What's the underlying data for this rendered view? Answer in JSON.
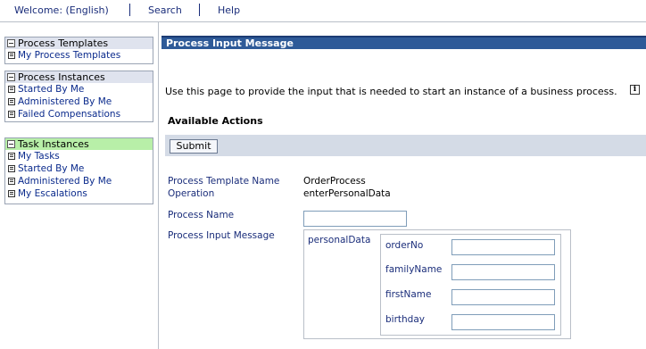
{
  "topnav": {
    "welcome": "Welcome: (English)",
    "search": "Search",
    "help": "Help"
  },
  "sidebar": {
    "groups": [
      {
        "title": "Process Templates",
        "items": [
          "My Process Templates"
        ]
      },
      {
        "title": "Process Instances",
        "items": [
          "Started By Me",
          "Administered By Me",
          "Failed Compensations"
        ]
      },
      {
        "title": "Task Instances",
        "items": [
          "My Tasks",
          "Started By Me",
          "Administered By Me",
          "My Escalations"
        ]
      }
    ],
    "colors": {
      "group_head": "#dfe3ee",
      "task_head_active": "#b8efa8"
    }
  },
  "main": {
    "title": "Process Input Message",
    "intro": "Use this page to provide the input that is needed to start an instance of a business process.",
    "info_icon": "i",
    "available_actions": "Available Actions",
    "submit_label": "Submit",
    "template_name_label": "Process Template Name",
    "template_name_value": "OrderProcess",
    "operation_label": "Operation",
    "operation_value": "enterPersonalData",
    "process_name_label": "Process Name",
    "process_name_value": "",
    "input_message_label": "Process Input Message",
    "message_part": "personalData",
    "fields": [
      {
        "label": "orderNo",
        "value": ""
      },
      {
        "label": "familyName",
        "value": ""
      },
      {
        "label": "firstName",
        "value": ""
      },
      {
        "label": "birthday",
        "value": ""
      }
    ]
  },
  "colors": {
    "title_bar": "#2e5a98",
    "action_bar": "#d4dbe6",
    "link": "#0a2a8c"
  }
}
